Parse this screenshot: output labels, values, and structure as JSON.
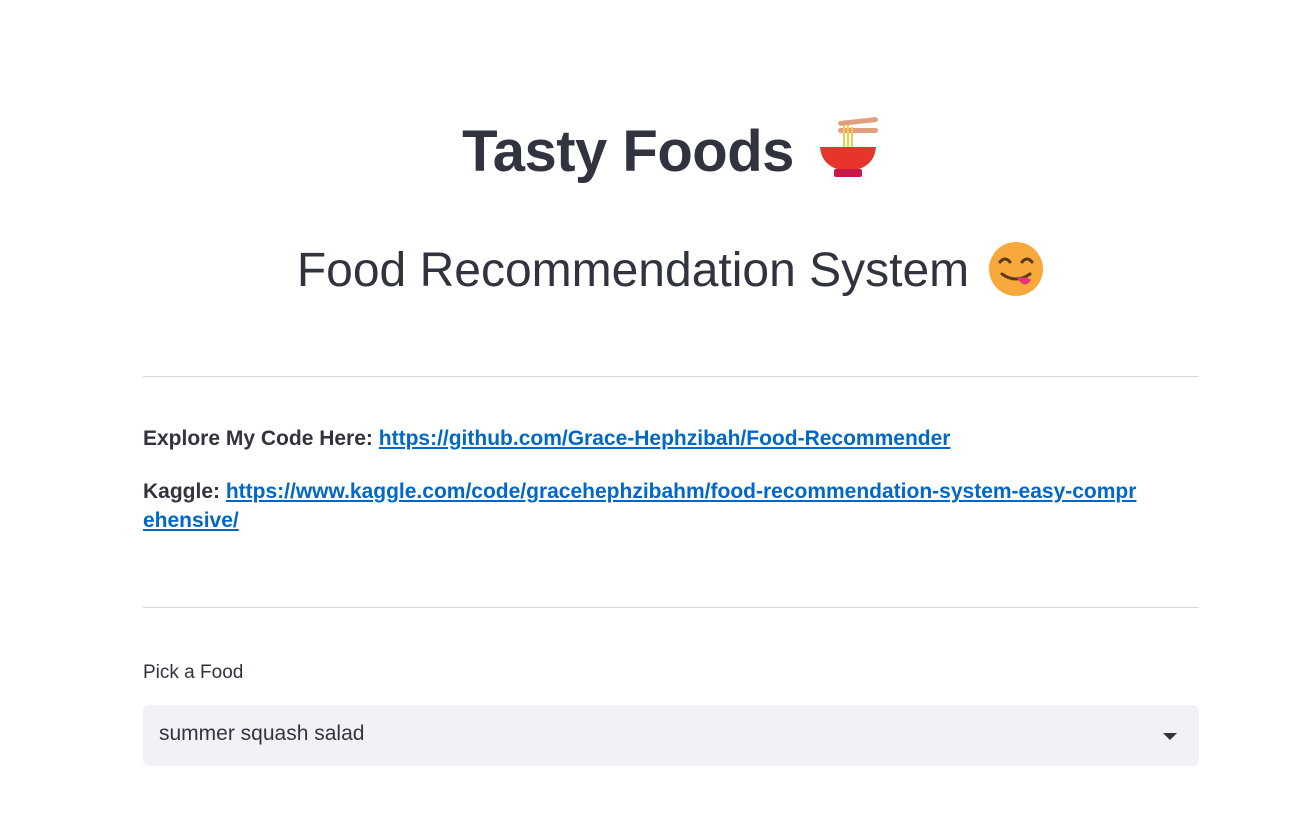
{
  "header": {
    "title": "Tasty Foods",
    "title_icon": "ramen-bowl-icon",
    "subtitle": "Food Recommendation System",
    "subtitle_icon": "yum-face-icon"
  },
  "links": {
    "code_label": "Explore My Code Here:",
    "code_url": "https://github.com/Grace-Hephzibah/Food-Recommender",
    "kaggle_label": "Kaggle:",
    "kaggle_url": "https://www.kaggle.com/code/gracehephzibahm/food-recommendation-system-easy-comprehensive/"
  },
  "picker": {
    "label": "Pick a Food",
    "selected": "summer squash salad"
  },
  "colors": {
    "text": "#31333f",
    "link": "#0068c9",
    "select_bg": "#f0f2f6",
    "divider": "#d8d8dc"
  }
}
